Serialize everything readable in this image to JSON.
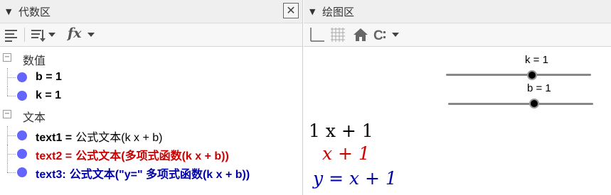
{
  "algebra": {
    "title": "代数区",
    "close_icon": "close-icon",
    "toolbar": {
      "fx": "fx"
    },
    "categories": [
      {
        "label": "数值",
        "items": [
          {
            "text": "b = 1"
          },
          {
            "text": "k = 1"
          }
        ]
      },
      {
        "label": "文本",
        "items": [
          {
            "name": "text1 =",
            "value": "公式文本(k x + b)",
            "color": "#000000"
          },
          {
            "name": "text2 =",
            "value": "公式文本(多项式函数(k x + b))",
            "color": "#cc0000"
          },
          {
            "name": "text3:",
            "value": "公式文本(\"y=\" 多项式函数(k x + b))",
            "color": "#0000aa"
          }
        ]
      }
    ],
    "point_color": "#6464ff"
  },
  "graphics": {
    "title": "绘图区",
    "sliders": [
      {
        "label": "k = 1",
        "value": 1
      },
      {
        "label": "b = 1",
        "value": 1
      }
    ],
    "formulas": [
      {
        "text": "1 x + 1",
        "color": "#000000"
      },
      {
        "text": "x + 1",
        "color": "#cc0000"
      },
      {
        "text": "y = x + 1",
        "color": "#0000aa"
      }
    ]
  }
}
